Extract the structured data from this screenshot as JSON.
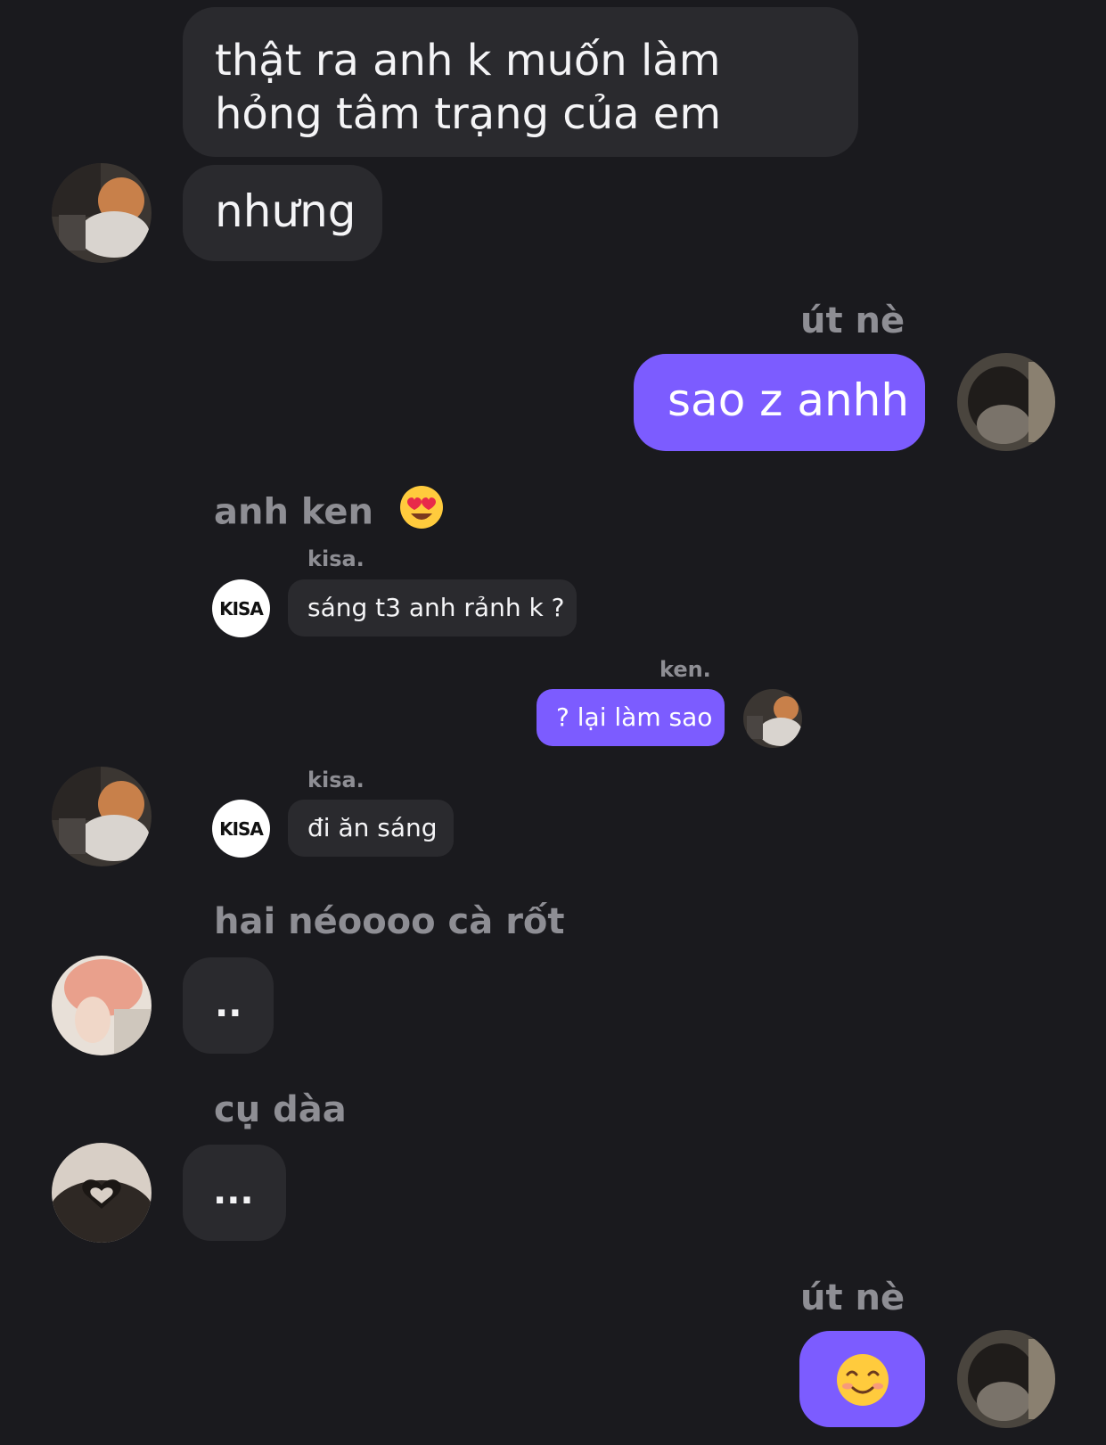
{
  "messages": {
    "m1_text": "thật ra anh k muốn làm hỏng tâm trạng của em",
    "m2_text": "nhưng",
    "ut_ne_1": "út nè",
    "m3_text": "sao z anhh",
    "anh_ken": "anh ken",
    "kisa_1": "kisa.",
    "reply_1": "sáng t3 anh rảnh k ?",
    "ken": "ken.",
    "reply_2": "? lại làm sao",
    "kisa_2": "kisa.",
    "reply_3": "đi ăn sáng",
    "hai_neo": "hai néoooo cà rốt",
    "m4_text": "..",
    "cu_daa": "cụ dàa",
    "m5_text": "...",
    "ut_ne_2": "út nè",
    "kisa_logo": "KISA"
  },
  "colors": {
    "background": "#1a1a1e",
    "incoming": "#2a2a2e",
    "outgoing": "#7c5cff",
    "muted": "#8e8e94"
  },
  "icons": {
    "heart_eyes": "heart-eyes-emoji",
    "smile": "smiling-face-emoji"
  }
}
